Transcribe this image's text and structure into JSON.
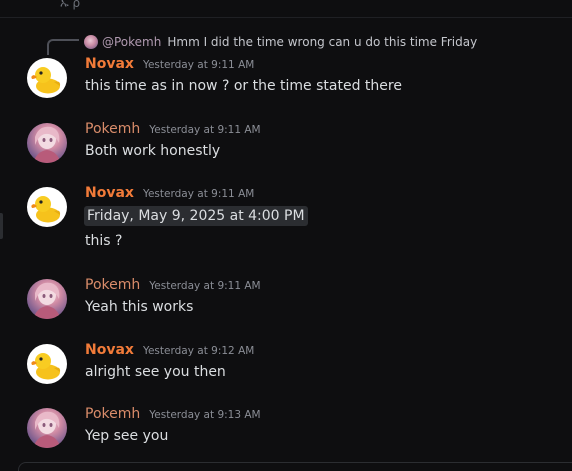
{
  "header_fragment": "ኡ ρ",
  "reply": {
    "author": "@Pokemh",
    "text": "Hmm I did the time wrong can u do this time Friday"
  },
  "messages": [
    {
      "author": "Novax",
      "timestamp": "Yesterday at 9:11 AM",
      "text": "this time as in now ? or the time stated there"
    },
    {
      "author": "Pokemh",
      "timestamp": "Yesterday at 9:11 AM",
      "text": "Both work honestly"
    },
    {
      "author": "Novax",
      "timestamp": "Yesterday at 9:11 AM",
      "time_chip": "Friday, May 9, 2025 at 4:00 PM",
      "text": "this ?"
    },
    {
      "author": "Pokemh",
      "timestamp": "Yesterday at 9:11 AM",
      "text": "Yeah this works"
    },
    {
      "author": "Novax",
      "timestamp": "Yesterday at 9:12 AM",
      "text": "alright see you then"
    },
    {
      "author": "Pokemh",
      "timestamp": "Yesterday at 9:13 AM",
      "text": "Yep see you"
    }
  ],
  "colors": {
    "background": "#0e0e10",
    "novax_name": "#f27b39",
    "pokemh_name": "#d98c6a",
    "timestamp": "#8b8e96",
    "chip_bg": "#2b2d31"
  },
  "icons": {
    "novax_avatar": "rubber-duck-icon",
    "pokemh_avatar": "anime-portrait-avatar"
  }
}
